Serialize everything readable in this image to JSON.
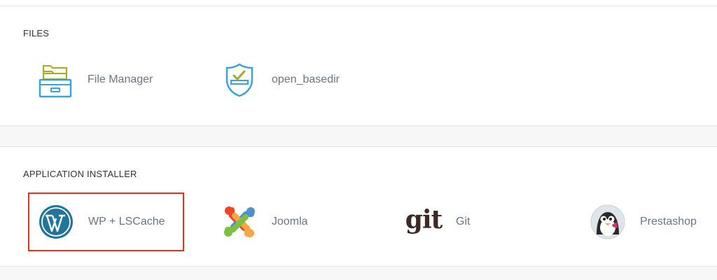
{
  "sections": {
    "files": {
      "title": "FILES",
      "items": [
        {
          "label": "File Manager",
          "icon": "file-manager-icon"
        },
        {
          "label": "open_basedir",
          "icon": "open-basedir-shield-icon"
        }
      ]
    },
    "application_installer": {
      "title": "APPLICATION INSTALLER",
      "items": [
        {
          "label": "WP + LSCache",
          "icon": "wordpress-icon"
        },
        {
          "label": "Joomla",
          "icon": "joomla-icon"
        },
        {
          "label": "Git",
          "icon": "git-icon",
          "icon_text": "git"
        },
        {
          "label": "Prestashop",
          "icon": "prestashop-icon"
        }
      ]
    }
  },
  "colors": {
    "label": "#6a7584",
    "highlight_border": "#e2341c",
    "wordpress_blue": "#21759b",
    "git_text": "#3d2a24"
  }
}
